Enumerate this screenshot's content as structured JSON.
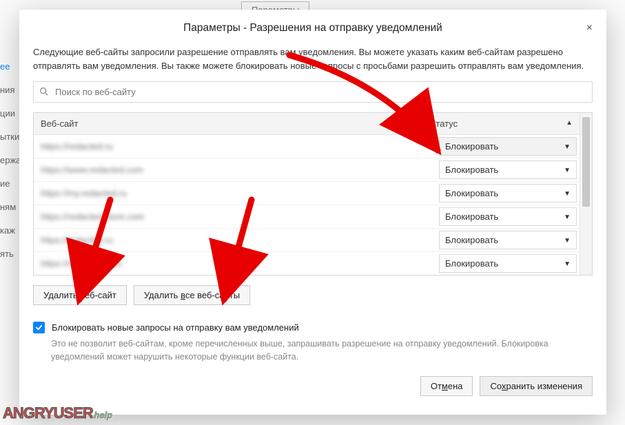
{
  "bg": {
    "button": "Параметры",
    "side": [
      "ее",
      "ния",
      "ции",
      "ытки",
      "ержа",
      "ие",
      "ням",
      "каж",
      "ять"
    ],
    "side_link_index": 0
  },
  "dialog": {
    "title": "Параметры - Разрешения на отправку уведомлений",
    "close_label": "×",
    "description": "Следующие веб-сайты запросили разрешение отправлять вам уведомления. Вы можете указать каким веб-сайтам разрешено отправлять вам уведомления. Вы также можете блокировать новые запросы с просьбами разрешить отправлять вам уведомления.",
    "search_placeholder": "Поиск по веб-сайту",
    "col_website": "Веб-сайт",
    "col_status": "Статус",
    "rows": [
      {
        "site": "https://redacted.ru",
        "status": "Блокировать",
        "selected": true
      },
      {
        "site": "https://www.redacted.com",
        "status": "Блокировать",
        "selected": false
      },
      {
        "site": "https://my.redacted.ru",
        "status": "Блокировать",
        "selected": false
      },
      {
        "site": "https://redacted.store.com",
        "status": "Блокировать",
        "selected": false
      },
      {
        "site": "https://redacted.ru",
        "status": "Блокировать",
        "selected": false
      },
      {
        "site": "https://redacted.com",
        "status": "Блокировать",
        "selected": false
      }
    ],
    "remove_site": "Удалить веб-сайт",
    "remove_all": "Удалить все веб-сайты",
    "remove_all_u_index": 8,
    "block_new_label": "Блокировать новые запросы на отправку вам уведомлений",
    "block_new_hint": "Это не позволит веб-сайтам, кроме перечисленных выше, запрашивать разрешение на отправку уведомлений. Блокировка уведомлений может нарушить некоторые функции веб-сайта.",
    "cancel": "Отмена",
    "cancel_u_index": 2,
    "save": "Сохранить изменения",
    "save_u_index": 2
  },
  "watermark": {
    "main": "ANGRYUSER",
    "suffix": ".help"
  }
}
